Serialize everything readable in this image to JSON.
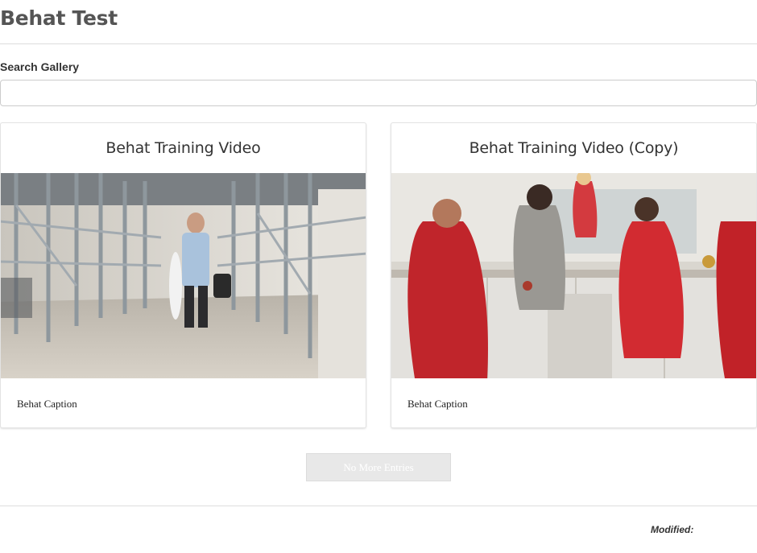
{
  "page": {
    "title": "Behat Test"
  },
  "search": {
    "label": "Search Gallery",
    "value": "",
    "placeholder": ""
  },
  "gallery": {
    "items": [
      {
        "title": "Behat Training Video",
        "caption": "Behat Caption",
        "thumbnail": "video-thumbnail-scaffolding-walkway"
      },
      {
        "title": "Behat Training Video (Copy)",
        "caption": "Behat Caption",
        "thumbnail": "video-thumbnail-kitchen-cheerleaders"
      }
    ]
  },
  "pager": {
    "button_label": "No More Entries"
  },
  "footer": {
    "modified_label": "Modified:"
  },
  "colors": {
    "rule": "#dddddd",
    "button_bg": "#e8e8e8",
    "button_text": "#ffffff"
  }
}
